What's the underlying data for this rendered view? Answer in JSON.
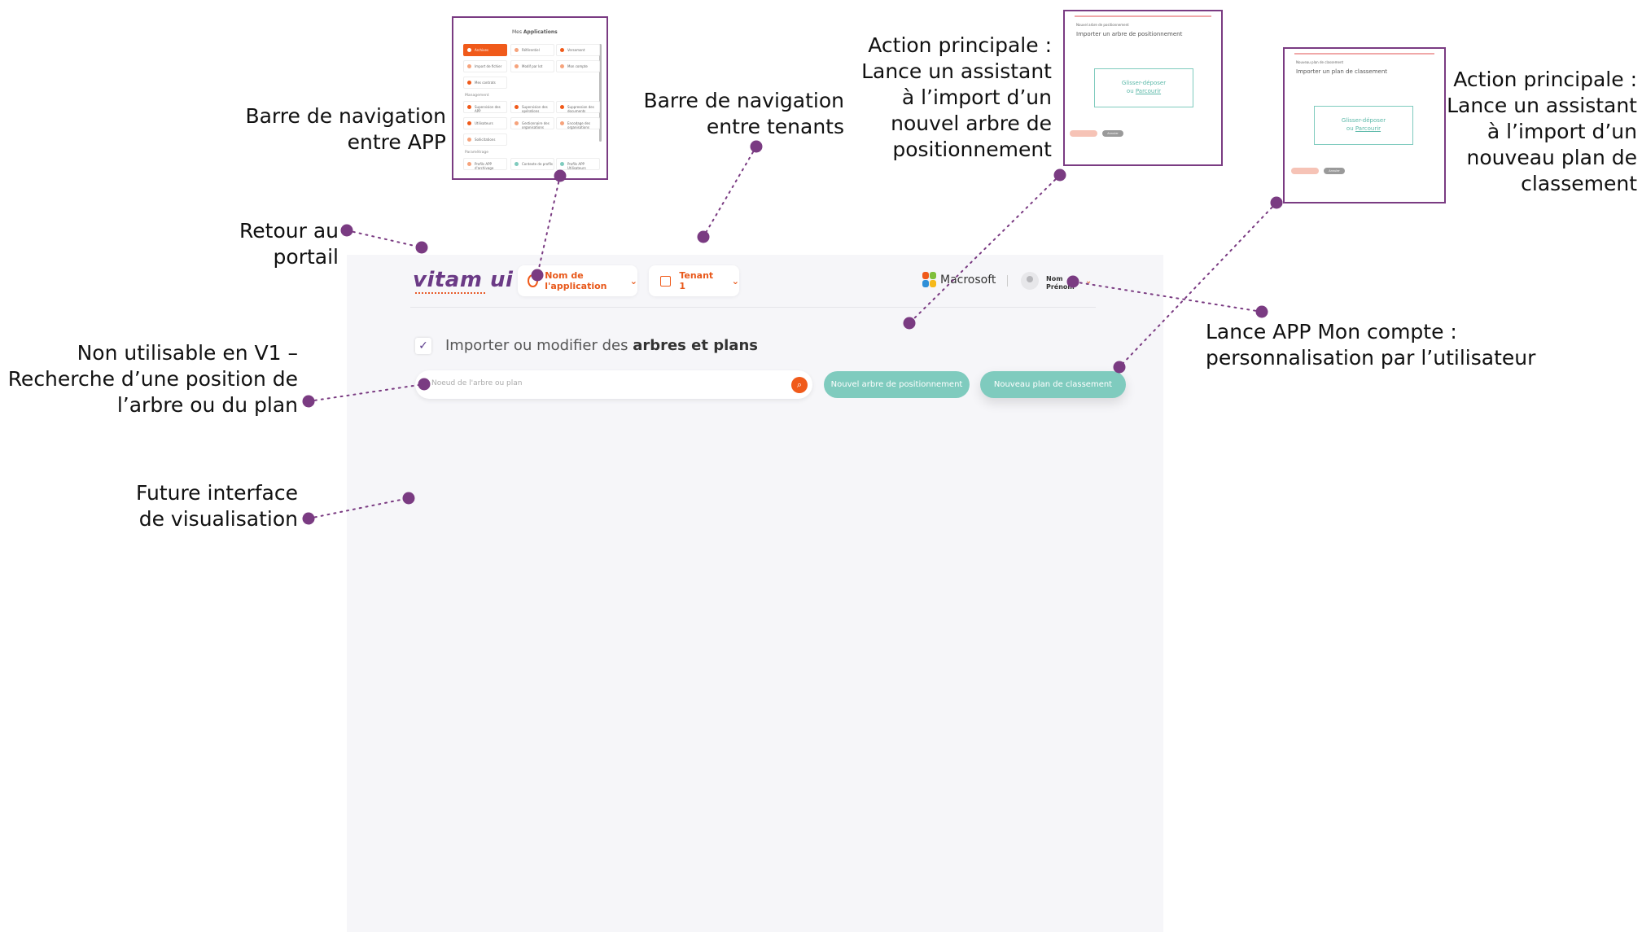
{
  "annotations": {
    "app_nav": [
      "Barre de navigation",
      "entre APP"
    ],
    "tenant_nav": [
      "Barre de navigation",
      "entre tenants"
    ],
    "action_tree": [
      "Action principale :",
      "Lance un assistant",
      "à l’import d’un",
      "nouvel arbre de",
      "positionnement"
    ],
    "action_plan": [
      "Action principale :",
      "Lance un assistant",
      "à l’import d’un",
      "nouveau plan de",
      "classement"
    ],
    "back_portal": [
      "Retour au",
      "portail"
    ],
    "account": [
      "Lance APP Mon compte :",
      "personnalisation par l’utilisateur"
    ],
    "search_note": [
      "Non utilisable en V1 –",
      "Recherche d’une position de",
      "l’arbre ou du plan"
    ],
    "future": [
      "Future interface",
      "de visualisation"
    ]
  },
  "header": {
    "logo": "vitam ui",
    "app_selector": "Nom de l'application",
    "tenant_selector": "Tenant 1",
    "customer_logo": "Macrosoft",
    "user_name_line1": "Nom",
    "user_name_line2": "Prénom"
  },
  "main": {
    "heading_prefix": "Importer ou modifier des ",
    "heading_bold": "arbres et plans",
    "search_placeholder": "Noeud de l'arbre ou plan",
    "btn_new_tree": "Nouvel arbre de positionnement",
    "btn_new_plan": "Nouveau plan de classement"
  },
  "app_switcher": {
    "title_prefix": "Mes ",
    "title_bold": "Applications",
    "row1": [
      "Archives",
      "Référentiel",
      "Versement"
    ],
    "row2": [
      "Import de fichier",
      "Modif par lot",
      "Mon compte"
    ],
    "row3": [
      "Mes contrats"
    ],
    "section_management": "Management",
    "row4": [
      "Supervision des APP",
      "Supervision des opérations",
      "Suppression des documents"
    ],
    "row5": [
      "Utilisateurs",
      "Gestionnaire des organisations",
      "Encodage des organisations"
    ],
    "row6": [
      "Sollicitations"
    ],
    "section_paramétrage": "Paramétrage",
    "row7": [
      "Profils APP d'archivage",
      "Contexte de profils",
      "Profils APP Utilisateurs"
    ]
  },
  "wizard_tree": {
    "small": "Nouvel arbre de positionnement",
    "title": "Importer un arbre de positionnement",
    "drop_line1": "Glisser-déposer",
    "drop_line2_prefix": "ou ",
    "drop_link": "Parcourir",
    "btn_cancel": "Annuler"
  },
  "wizard_plan": {
    "small": "Nouveau plan de classement",
    "title": "Importer un plan de classement",
    "drop_line1": "Glisser-déposer",
    "drop_line2_prefix": "ou ",
    "drop_link": "Parcourir",
    "btn_cancel": "Annuler"
  },
  "colors": {
    "accent_orange": "#f05a1a",
    "accent_teal": "#7fcbbe",
    "accent_purple": "#7a3b82"
  }
}
